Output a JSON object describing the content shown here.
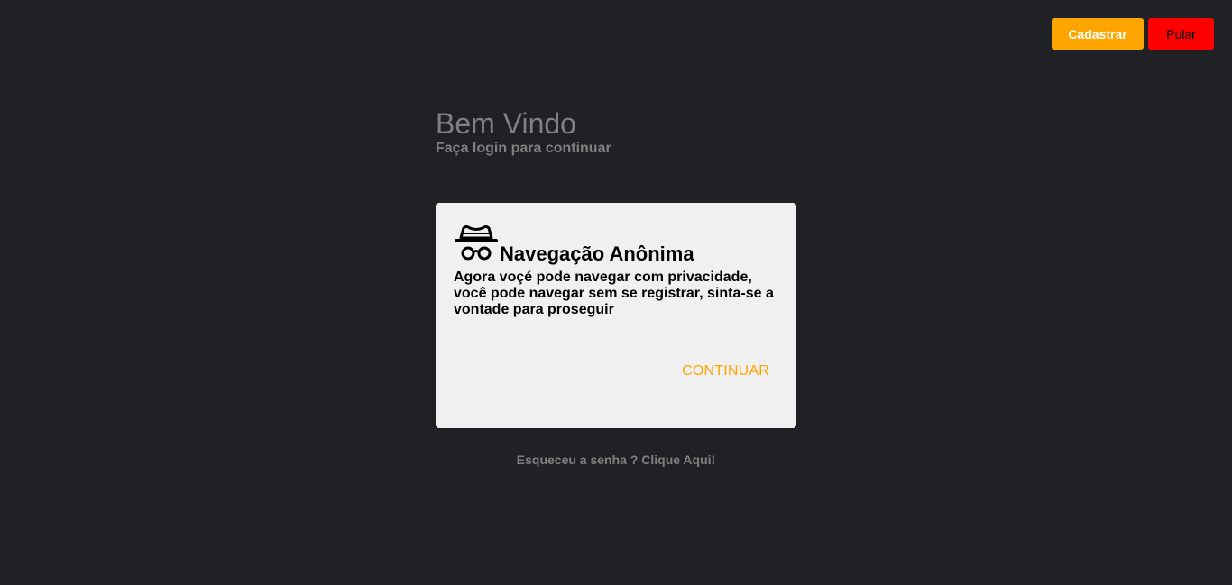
{
  "header_actions": {
    "register_label": "Cadastrar",
    "skip_label": "Pular"
  },
  "welcome": {
    "title": "Bem Vindo",
    "subtitle": "Faça login para continuar"
  },
  "anonymous_card": {
    "icon": "incognito-icon",
    "title": "Navegação Anônima",
    "description": "Agora voçé pode navegar com privacidade, você pode navegar sem se registrar, sinta-se a vontade para proseguir",
    "continue_label": "CONTINUAR"
  },
  "forgot_password": {
    "label": "Esqueceu a senha ? Clique Aqui!"
  },
  "colors": {
    "background": "#202125",
    "accent": "#ffa500",
    "danger": "#ff0000",
    "muted_text": "#808080",
    "card_background": "#f0f0f0"
  }
}
